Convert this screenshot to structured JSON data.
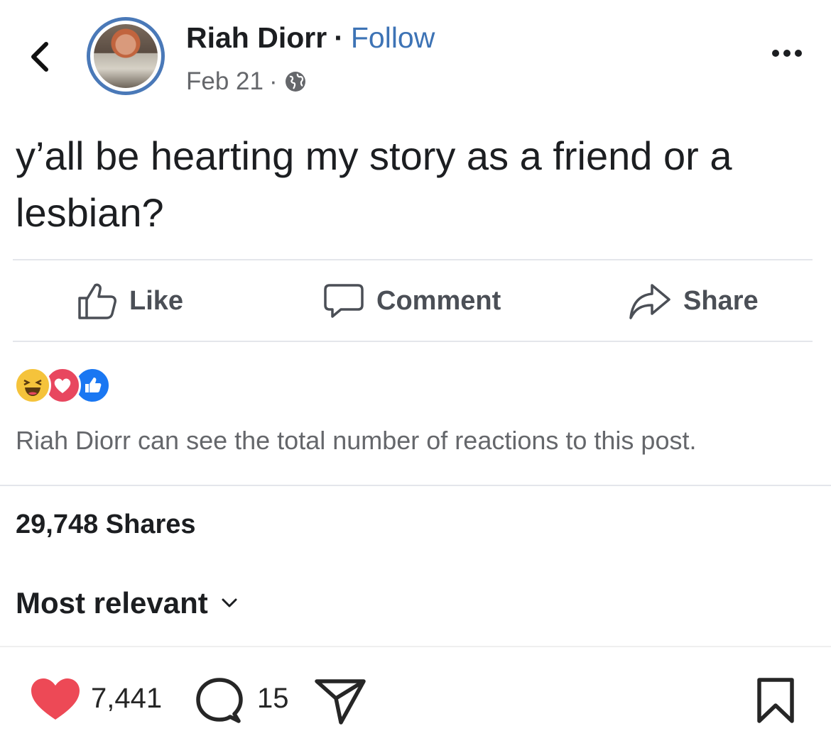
{
  "header": {
    "back_icon": "chevron-left-icon",
    "author_name": "Riah Diorr",
    "separator": "·",
    "follow_label": "Follow",
    "date": "Feb 21",
    "meta_separator": "·",
    "privacy_icon": "globe-icon",
    "more_icon": "more-horizontal-icon"
  },
  "post": {
    "text": "y’all be hearting my story as a friend or a lesbian?"
  },
  "actions": {
    "like_label": "Like",
    "comment_label": "Comment",
    "share_label": "Share"
  },
  "reactions": {
    "icons": [
      "haha-reaction-icon",
      "love-reaction-icon",
      "like-reaction-icon"
    ],
    "note": "Riah Diorr can see the total number of reactions to this post."
  },
  "shares": {
    "label": "29,748 Shares"
  },
  "sort": {
    "label": "Most relevant"
  },
  "instagram_bar": {
    "like_count": "7,441",
    "comment_count": "15",
    "colors": {
      "heart": "#ed4956",
      "icon": "#262626"
    }
  },
  "colors": {
    "follow": "#3d73b5",
    "secondary_text": "#65676b",
    "avatar_ring": "#4a79b8"
  }
}
